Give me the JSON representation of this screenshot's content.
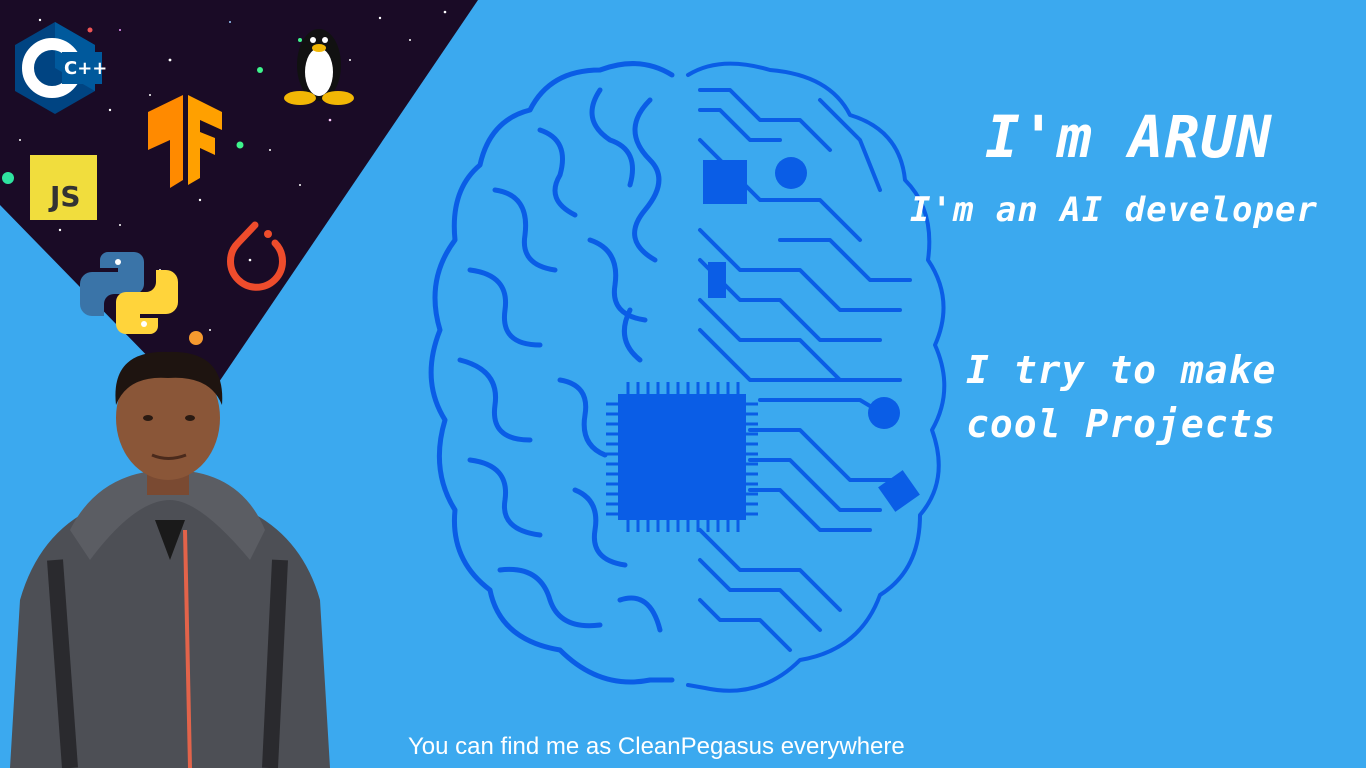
{
  "hero": {
    "title": "I'm ARUN",
    "role": "I'm an AI developer",
    "tagline_line1": "I try to make",
    "tagline_line2": "cool Projects"
  },
  "footer": {
    "text": "You can find me as CleanPegasus everywhere"
  },
  "logos": {
    "cpp": "C++",
    "js": "JS",
    "icons": [
      "cpp-icon",
      "linux-tux-icon",
      "tensorflow-icon",
      "javascript-icon",
      "pytorch-icon",
      "python-icon"
    ]
  },
  "colors": {
    "background": "#3ba9ef",
    "brain": "#0a5de6",
    "text": "#ffffff",
    "space": "#1a0b26"
  }
}
